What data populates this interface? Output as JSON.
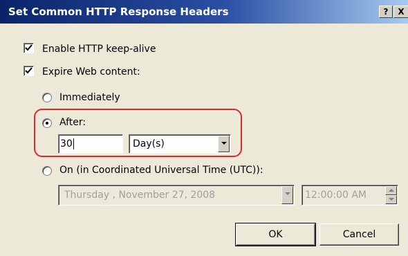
{
  "window": {
    "title": "Set Common HTTP Response Headers",
    "help_button": "?",
    "close_button": "X"
  },
  "options": {
    "keep_alive": {
      "label": "Enable HTTP keep-alive",
      "checked": true,
      "mnemonic": "k"
    },
    "expire": {
      "label": "Expire Web content:",
      "checked": true,
      "mnemonic": "W"
    }
  },
  "expire_modes": {
    "immediately": {
      "label": "Immediately",
      "selected": false
    },
    "after": {
      "label": "After:",
      "selected": true
    },
    "on": {
      "label": "On (in Coordinated Universal Time (UTC)):",
      "selected": false
    }
  },
  "after_fields": {
    "value": "30",
    "unit": "Day(s)"
  },
  "on_fields": {
    "date": "Thursday  ,  November  27, 2008",
    "time": "12:00:00 AM"
  },
  "buttons": {
    "ok": "OK",
    "cancel": "Cancel"
  },
  "colors": {
    "title_bar_start": "#0a246a",
    "title_bar_end": "#a6caf0",
    "highlight": "#e2262a",
    "dialog_face": "#ece9d8"
  }
}
